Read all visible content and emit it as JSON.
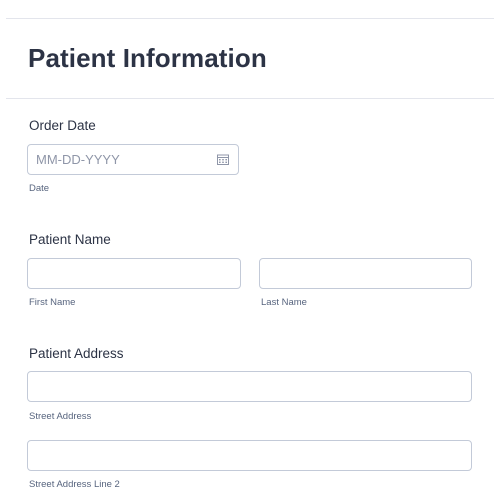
{
  "form": {
    "title": "Patient Information"
  },
  "order_date": {
    "label": "Order Date",
    "placeholder": "MM-DD-YYYY",
    "sublabel": "Date",
    "icon": "calendar-icon"
  },
  "patient_name": {
    "label": "Patient Name",
    "first_value": "",
    "last_value": "",
    "first_sublabel": "First Name",
    "last_sublabel": "Last Name"
  },
  "patient_address": {
    "label": "Patient Address",
    "street_value": "",
    "street_sublabel": "Street Address",
    "street2_value": "",
    "street2_sublabel": "Street Address Line 2"
  }
}
